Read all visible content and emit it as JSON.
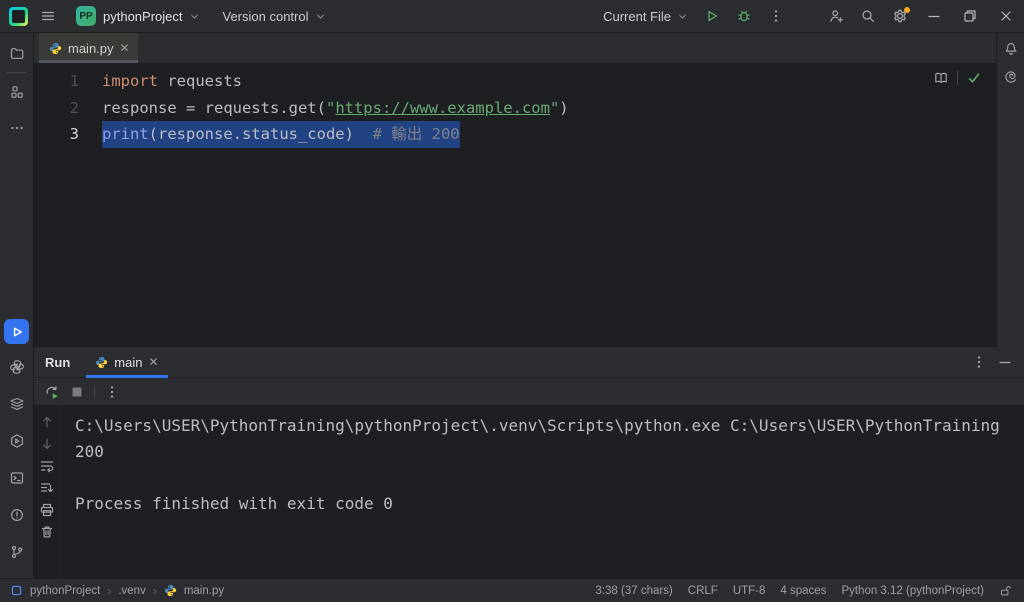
{
  "colors": {
    "accent_blue": "#3574f0",
    "run_green": "#5fad65",
    "selection_blue": "#214283",
    "gear_badge_orange": "#f5a623",
    "panel_bg": "#2b2d30",
    "editor_bg": "#1e1f22"
  },
  "title_bar": {
    "project_initials": "PP",
    "project_name": "pythonProject",
    "version_control_label": "Version control",
    "run_config_label": "Current File",
    "icons": [
      "main-menu",
      "hamburger",
      "run",
      "debug",
      "more",
      "add-user",
      "search",
      "settings",
      "minimize",
      "restore",
      "close"
    ]
  },
  "left_stripe_icons_top": [
    "project-folder",
    "structure",
    "more-tool-windows"
  ],
  "left_stripe_icons_bottom": [
    "run (active)",
    "python-console",
    "python-packages",
    "services",
    "terminal",
    "problems",
    "version-control"
  ],
  "right_stripe_icons": [
    "notifications-bell",
    "ai-assistant"
  ],
  "editor": {
    "tab_label": "main.py",
    "widget_icons": [
      "reader-mode-book",
      "inspections-ok-check"
    ],
    "lines": [
      {
        "number": "1",
        "selected": false,
        "segments": [
          {
            "type": "keyword",
            "text": "import"
          },
          {
            "type": "plain",
            "text": " requests"
          }
        ]
      },
      {
        "number": "2",
        "selected": false,
        "segments": [
          {
            "type": "plain",
            "text": "response = requests.get("
          },
          {
            "type": "string",
            "text": "\""
          },
          {
            "type": "link",
            "text": "https://www.example.com"
          },
          {
            "type": "string",
            "text": "\""
          },
          {
            "type": "plain",
            "text": ")"
          }
        ]
      },
      {
        "number": "3",
        "selected": true,
        "segments": [
          {
            "type": "builtin",
            "text": "print"
          },
          {
            "type": "plain",
            "text": "(response.status_code)"
          },
          {
            "type": "comment",
            "text": "  # 輸出 200"
          }
        ]
      }
    ]
  },
  "run_panel": {
    "panel_label": "Run",
    "tab_label": "main",
    "toolbar_icons": [
      "rerun",
      "stop (disabled)",
      "more"
    ],
    "console_tool_icons": [
      "scroll-up",
      "scroll-down",
      "soft-wrap",
      "scroll-to-end",
      "print",
      "clear"
    ],
    "console_lines": [
      "C:\\Users\\USER\\PythonTraining\\pythonProject\\.venv\\Scripts\\python.exe C:\\Users\\USER\\PythonTraining",
      "200",
      "",
      "Process finished with exit code 0"
    ]
  },
  "status_bar": {
    "breadcrumbs": [
      "pythonProject",
      ".venv",
      "main.py"
    ],
    "caret_position": "3:38 (37 chars)",
    "line_ending": "CRLF",
    "encoding": "UTF-8",
    "indent": "4 spaces",
    "interpreter": "Python 3.12 (pythonProject)"
  }
}
